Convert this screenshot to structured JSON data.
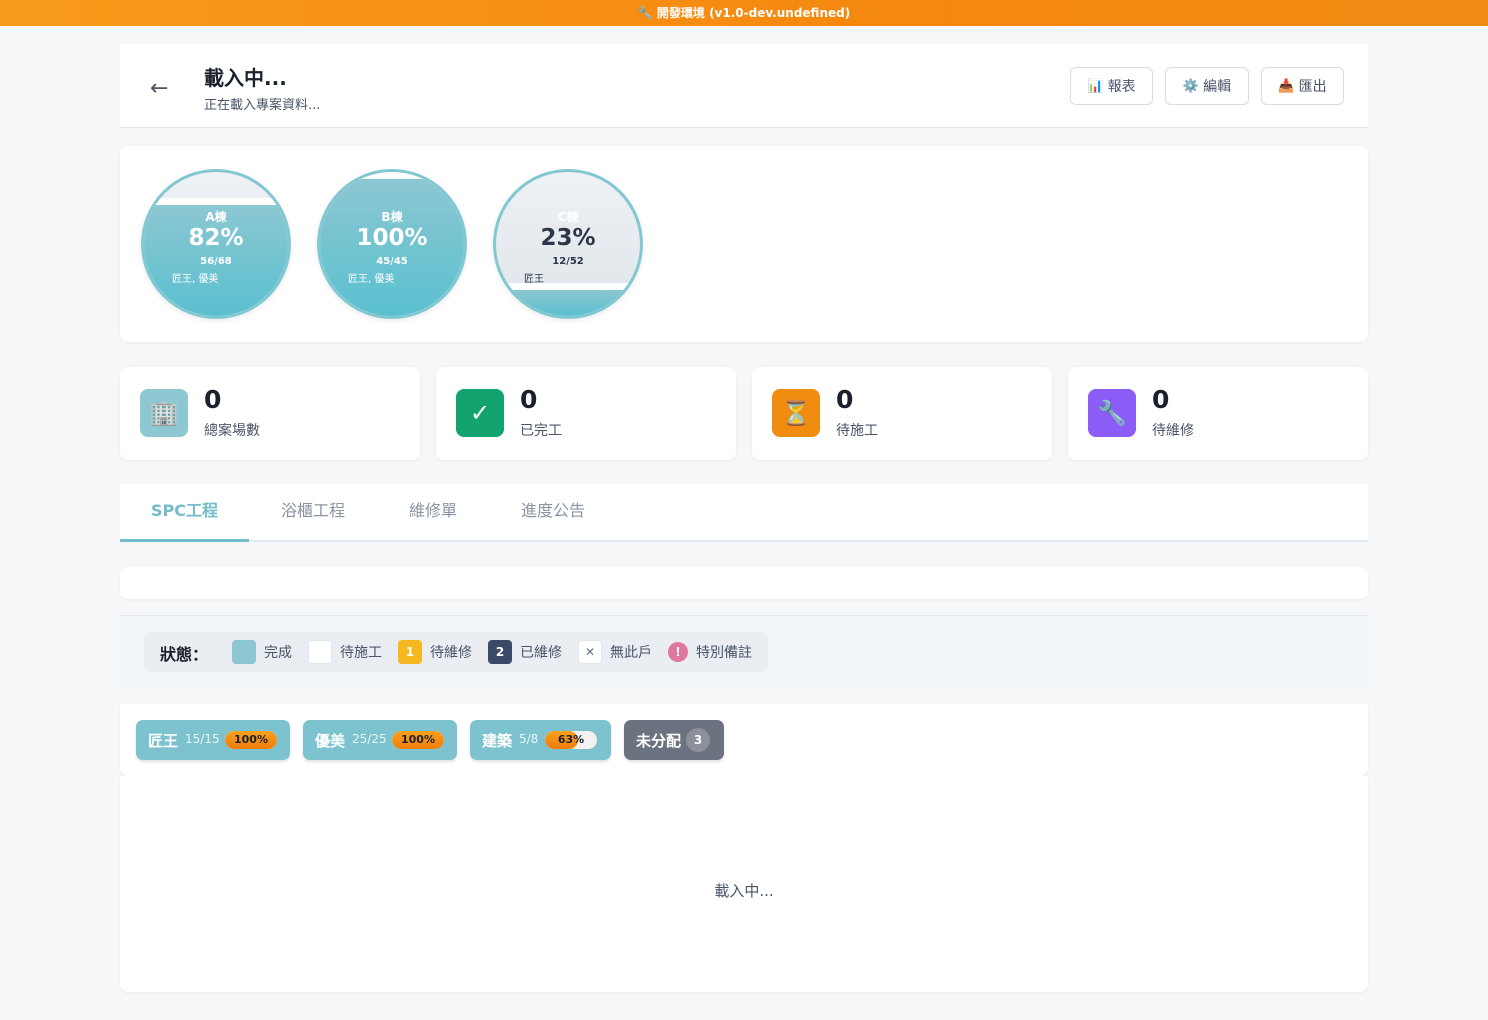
{
  "env_banner": "🔧 開發環境 (v1.0-dev.undefined)",
  "header": {
    "back_icon": "←",
    "title": "載入中...",
    "subtitle": "正在載入專案資料...",
    "buttons": [
      {
        "icon": "📊",
        "label": "報表"
      },
      {
        "icon": "⚙️",
        "label": "編輯"
      },
      {
        "icon": "📥",
        "label": "匯出"
      }
    ]
  },
  "buildings": [
    {
      "name": "A棟",
      "percent": "82%",
      "progress": 0.82,
      "count": "56/68",
      "teams": "匠王, 優美"
    },
    {
      "name": "B棟",
      "percent": "100%",
      "progress": 1.0,
      "count": "45/45",
      "teams": "匠王, 優美"
    },
    {
      "name": "C棟",
      "percent": "23%",
      "progress": 0.23,
      "count": "12/52",
      "teams": "匠王"
    }
  ],
  "stats": [
    {
      "icon": "🏢",
      "value": "0",
      "label": "總案場數",
      "color": "#8cc7d2"
    },
    {
      "icon": "✓",
      "value": "0",
      "label": "已完工",
      "color": "#12a36f"
    },
    {
      "icon": "⏳",
      "value": "0",
      "label": "待施工",
      "color": "#f08c10"
    },
    {
      "icon": "🔧",
      "value": "0",
      "label": "待維修",
      "color": "#8b5cf6"
    }
  ],
  "tabs": [
    "SPC工程",
    "浴櫃工程",
    "維修單",
    "進度公告"
  ],
  "legend": {
    "title": "狀態：",
    "items": [
      {
        "symbol": "",
        "label": "完成"
      },
      {
        "symbol": "",
        "label": "待施工"
      },
      {
        "symbol": "1",
        "label": "待維修"
      },
      {
        "symbol": "2",
        "label": "已維修"
      },
      {
        "symbol": "✕",
        "label": "無此戶"
      },
      {
        "symbol": "!",
        "label": "特別備註"
      }
    ]
  },
  "teams": [
    {
      "name": "匠王",
      "count": "15/15",
      "percent": "100%",
      "progress": 1.0
    },
    {
      "name": "優美",
      "count": "25/25",
      "percent": "100%",
      "progress": 1.0
    },
    {
      "name": "建築",
      "count": "5/8",
      "percent": "63%",
      "progress": 0.63
    }
  ],
  "unassigned": {
    "label": "未分配",
    "count": "3"
  },
  "content": {
    "loading": "載入中..."
  }
}
